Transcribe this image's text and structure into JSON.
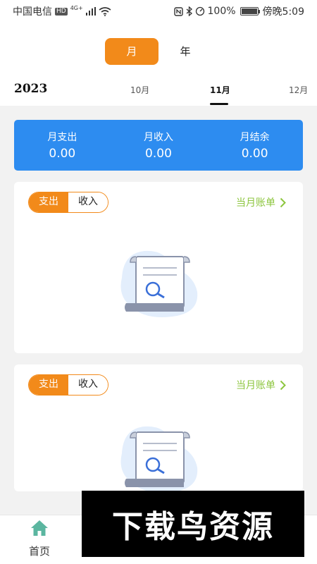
{
  "status_bar": {
    "carrier": "中国电信",
    "hd": "HD",
    "network": "4G+",
    "battery": "100%",
    "time": "傍晚5:09"
  },
  "period": {
    "month": "月",
    "year": "年",
    "selected": "月"
  },
  "calendar": {
    "year": "2023",
    "months": [
      "10月",
      "11月",
      "12月"
    ],
    "selected_month": "11月"
  },
  "summary": {
    "expense_label": "月支出",
    "expense_value": "0.00",
    "income_label": "月收入",
    "income_value": "0.00",
    "balance_label": "月结余",
    "balance_value": "0.00"
  },
  "cards": [
    {
      "expense_tab": "支出",
      "income_tab": "收入",
      "link": "当月账单"
    },
    {
      "expense_tab": "支出",
      "income_tab": "收入",
      "link": "当月账单"
    }
  ],
  "tab_bar": {
    "home": "首页"
  },
  "watermark": "下载鸟资源",
  "colors": {
    "accent": "#f28a1a",
    "summary_bg": "#2d8cf0",
    "link": "#8dc63f",
    "home_icon": "#5bb6a0"
  }
}
